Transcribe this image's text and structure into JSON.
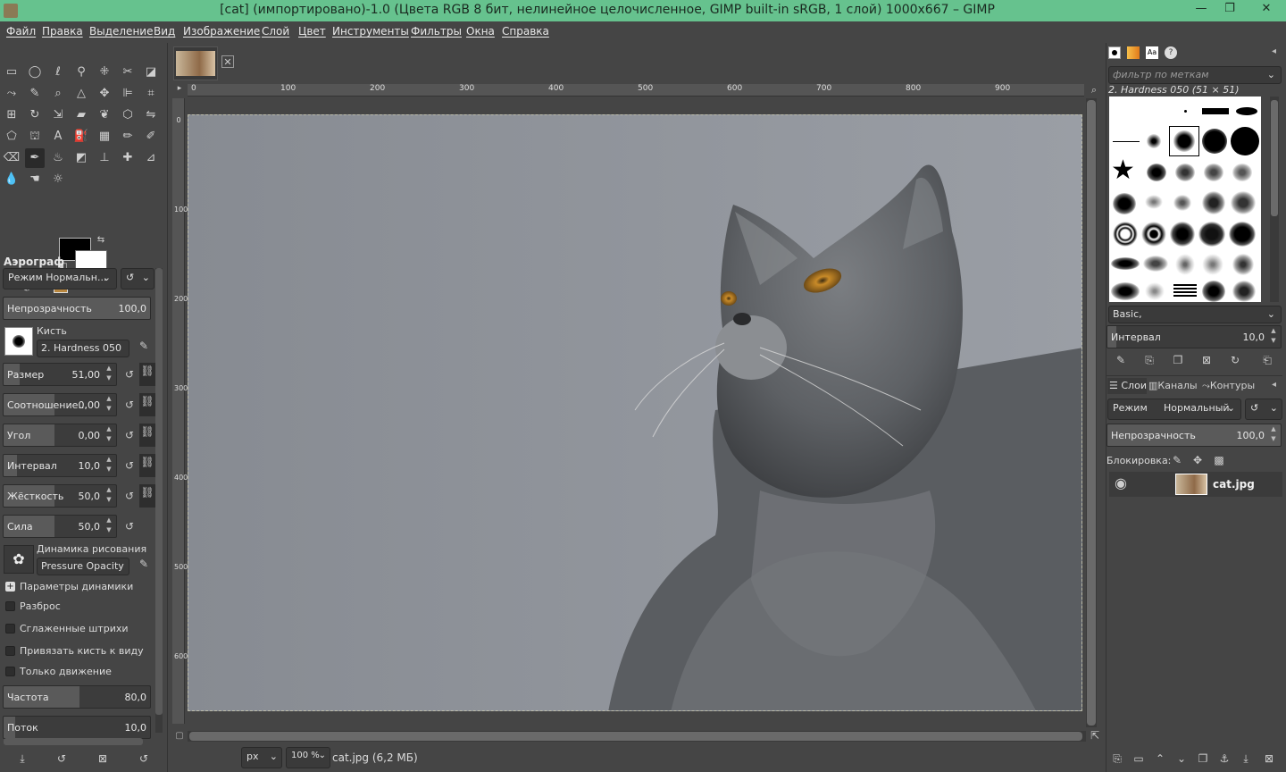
{
  "window": {
    "title": "[cat] (импортировано)-1.0 (Цвета RGB 8 бит, нелинейное целочисленное, GIMP built-in sRGB, 1 слой) 1000x667 – GIMP",
    "minimize": "—",
    "maximize": "❐",
    "close": "✕"
  },
  "menu": [
    "Файл",
    "Правка",
    "Выделение",
    "Вид",
    "Изображение",
    "Слой",
    "Цвет",
    "Инструменты",
    "Фильтры",
    "Окна",
    "Справка"
  ],
  "tool_options": {
    "title": "Аэрограф",
    "mode_label": "Режим Нормальн...",
    "opacity": {
      "label": "Непрозрачность",
      "value": "100,0"
    },
    "brush_label": "Кисть",
    "brush_name": "2. Hardness 050",
    "size": {
      "label": "Размер",
      "value": "51,00"
    },
    "ratio": {
      "label": "Соотношение...",
      "value": "0,00"
    },
    "angle": {
      "label": "Угол",
      "value": "0,00"
    },
    "spacing": {
      "label": "Интервал",
      "value": "10,0"
    },
    "hardness": {
      "label": "Жёсткость",
      "value": "50,0"
    },
    "force": {
      "label": "Сила",
      "value": "50,0"
    },
    "dynamics_label": "Динамика рисования",
    "dynamics_name": "Pressure Opacity",
    "dynamics_params": "Параметры динамики",
    "scatter": "Разброс",
    "smooth": "Сглаженные штрихи",
    "lock_view": "Привязать кисть к виду",
    "motion_only": "Только движение",
    "rate": {
      "label": "Частота",
      "value": "80,0"
    },
    "flow": {
      "label": "Поток",
      "value": "10,0"
    }
  },
  "ruler": {
    "h_ticks": [
      "0",
      "100",
      "200",
      "300",
      "400",
      "500",
      "600",
      "700",
      "800",
      "900"
    ],
    "v_ticks": [
      "0",
      "100",
      "200",
      "300",
      "400",
      "500",
      "600"
    ]
  },
  "status": {
    "unit": "px",
    "zoom": "100 %",
    "file_info": "cat.jpg (6,2 МБ)"
  },
  "brushes_panel": {
    "filter_placeholder": "фильтр по меткам",
    "selected_brush": "2. Hardness 050 (51 × 51)",
    "preset": "Basic,",
    "spacing": {
      "label": "Интервал",
      "value": "10,0"
    }
  },
  "layers_panel": {
    "tabs": [
      "Слои",
      "Каналы",
      "Контуры"
    ],
    "mode_label": "Режим",
    "mode_value": "Нормальный",
    "opacity": {
      "label": "Непрозрачность",
      "value": "100,0"
    },
    "lock_label": "Блокировка:",
    "layer_name": "cat.jpg"
  }
}
